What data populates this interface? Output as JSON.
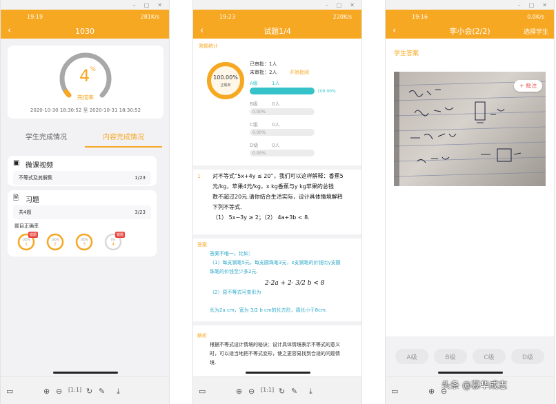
{
  "screens": [
    {
      "status": {
        "time": "19:19",
        "right": "281K/s"
      },
      "title": "1030",
      "progress": {
        "value": 4,
        "unit": "%",
        "label": "完成率",
        "time_range": "2020-10-30 18:30:52 至 2020-10-31 18:30:52"
      },
      "tabs": [
        {
          "label": "学生完成情况"
        },
        {
          "label": "内容完成情况",
          "active": true
        }
      ],
      "video": {
        "title": "微课视频",
        "item": "不等式及其解集",
        "count": "1/23"
      },
      "exercise": {
        "title": "习题",
        "item": "共4题",
        "count": "3/23",
        "accuracy_label": "题目正确率",
        "rings": [
          {
            "num": "1",
            "pct": "100%",
            "badge": "错题"
          },
          {
            "num": "2",
            "pct": "100%",
            "badge": ""
          },
          {
            "num": "3",
            "pct": "100%",
            "badge": ""
          },
          {
            "num": "4",
            "pct": "0%",
            "badge": "错题"
          }
        ]
      }
    },
    {
      "status": {
        "time": "19:23",
        "right": "220K/s"
      },
      "title": "试题1/4",
      "stats": {
        "section_label": "答题统计",
        "ring_value": "100.00%",
        "ring_label": "正确率",
        "reviewed": "已审批：1人",
        "unreviewed": "未审批：2人",
        "start_review": "开始批阅",
        "grades": [
          {
            "name": "A级",
            "count": "1人",
            "pct": "100.00%",
            "fill": 1.0
          },
          {
            "name": "B级",
            "count": "0人",
            "pct": "0.00%",
            "fill": 0
          },
          {
            "name": "C级",
            "count": "0人",
            "pct": "0.00%",
            "fill": 0
          },
          {
            "name": "D级",
            "count": "0人",
            "pct": "0.00%",
            "fill": 0
          }
        ]
      },
      "question": {
        "num": "1",
        "line1": "对不等式“5x+4y ≤ 20”，我们可以这样解释：香蕉5",
        "line2": "元/kg，苹果4元/kg，x kg香蕉与y kg苹果的总钱",
        "line3": "数不超过20元.请你结合生活实际，设计具体情境解释",
        "line4": "下列不等式.",
        "line5": "（1） 5x−3y ≥ 2；（2） 4a+3b < 8."
      },
      "answer": {
        "label": "答案",
        "l1": "答案不唯一，比如：",
        "l2": "（1）每支钢笔5元，每支圆珠笔3元，x支钢笔的价钱比y支圆",
        "l3": "珠笔的价钱至少多2元.",
        "formula": "2·2a + 2· 3/2 b < 8",
        "l4": "（2）原不等式可变形为",
        "l5": "长为2a cm，宽为 3/2 b cm的长方形，周长小于8cm."
      },
      "analysis": {
        "label": "解析",
        "l1": "根据不等式设计情境的秘诀：设计具体情境表示不等式的意义",
        "l2": "时，可以适当地把不等式变形，使之更容易找到合适的问题情",
        "l3": "境."
      }
    },
    {
      "status": {
        "time": "19:16",
        "right": "0.0K/s"
      },
      "title": "李小会(2/2)",
      "select_student": "选择学生",
      "section_label": "学生答案",
      "annotate": "+ 批注",
      "grade_buttons": [
        "A级",
        "B级",
        "C级",
        "D级"
      ]
    }
  ],
  "watermark": "头条 @慕华成志",
  "colors": {
    "accent": "#f7a823",
    "cyan": "#35c3c9",
    "red": "#e9463f"
  }
}
